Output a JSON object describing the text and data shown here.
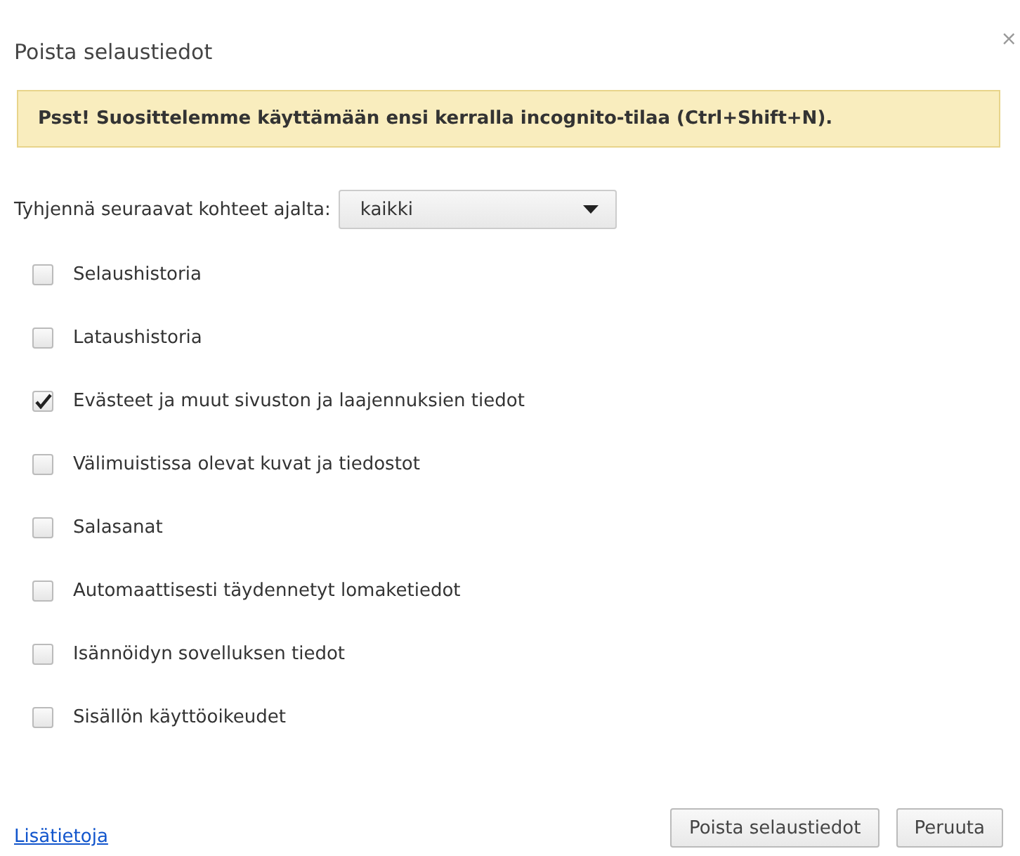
{
  "window": {
    "title": "Poista selaustiedot",
    "close": "×"
  },
  "notice": "Psst! Suosittelemme käyttämään ensi kerralla incognito-tilaa (Ctrl+Shift+N).",
  "range": {
    "label": "Tyhjennä seuraavat kohteet ajalta:",
    "value": "kaikki"
  },
  "items": [
    {
      "label": "Selaushistoria",
      "checked": false
    },
    {
      "label": "Lataushistoria",
      "checked": false
    },
    {
      "label": "Evästeet ja muut sivuston ja laajennuksien tiedot",
      "checked": true
    },
    {
      "label": "Välimuistissa olevat kuvat ja tiedostot",
      "checked": false
    },
    {
      "label": "Salasanat",
      "checked": false
    },
    {
      "label": "Automaattisesti täydennetyt lomaketiedot",
      "checked": false
    },
    {
      "label": "Isännöidyn sovelluksen tiedot",
      "checked": false
    },
    {
      "label": "Sisällön käyttöoikeudet",
      "checked": false
    }
  ],
  "link": "Lisätietoja",
  "buttons": [
    "Poista selaustiedot",
    "Peruuta"
  ]
}
